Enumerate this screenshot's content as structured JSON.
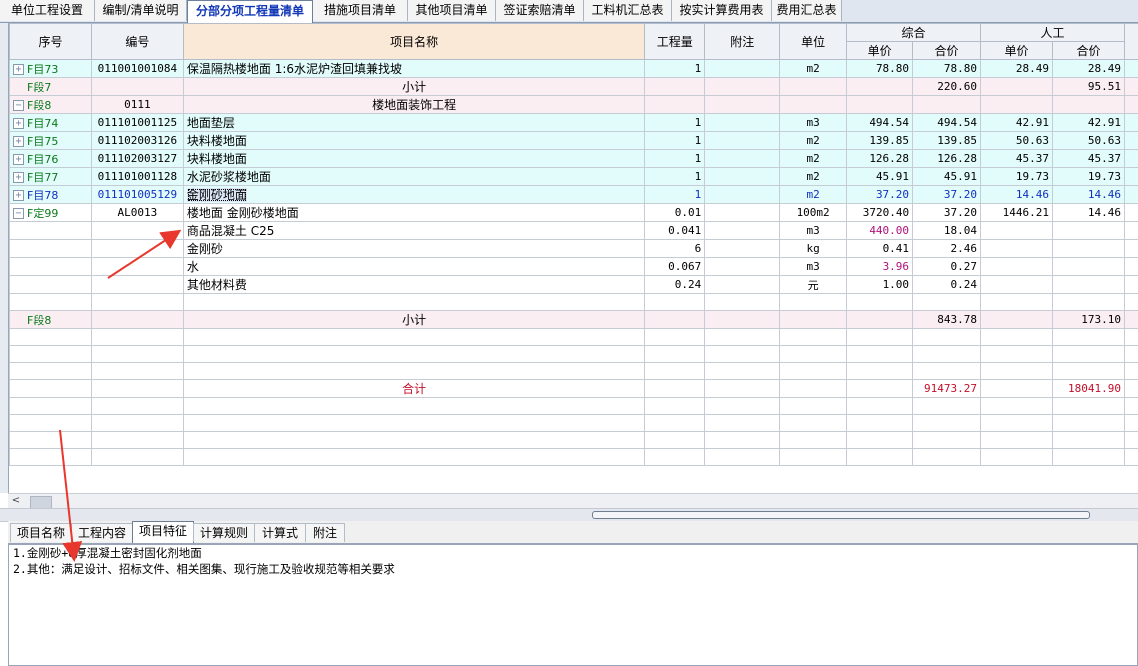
{
  "tabs": [
    {
      "label": "单位工程设置"
    },
    {
      "label": "编制/清单说明"
    },
    {
      "label": "分部分项工程量清单"
    },
    {
      "label": "措施项目清单"
    },
    {
      "label": "其他项目清单"
    },
    {
      "label": "签证索赔清单"
    },
    {
      "label": "工料机汇总表"
    },
    {
      "label": "按实计算费用表"
    },
    {
      "label": "费用汇总表"
    }
  ],
  "active_tab_index": 2,
  "table": {
    "headers": {
      "seq": "序号",
      "code": "编号",
      "name": "项目名称",
      "qty": "工程量",
      "note": "附注",
      "unit": "单位",
      "group_total": "综合",
      "group_labor": "人工",
      "unit_price": "单价",
      "amount": "合价"
    },
    "rows": [
      {
        "type": "item",
        "seq": "F目73",
        "code": "011001001084",
        "name": "保温隔热楼地面 1:6水泥炉渣回填兼找坡",
        "qty": "1",
        "unit": "m2",
        "price": "78.80",
        "amount": "78.80",
        "lprice": "28.49",
        "lamount": "28.49"
      },
      {
        "type": "sub",
        "seq": "F段7",
        "code": "",
        "name": "小计",
        "qty": "",
        "unit": "",
        "price": "",
        "amount": "220.60",
        "lprice": "",
        "lamount": "95.51"
      },
      {
        "type": "sub",
        "seq": "F段8",
        "code": "0111",
        "name": "楼地面装饰工程",
        "qty": "",
        "unit": "",
        "price": "",
        "amount": "",
        "lprice": "",
        "lamount": ""
      },
      {
        "type": "item",
        "seq": "F目74",
        "code": "011101001125",
        "name": "地面垫层",
        "qty": "1",
        "unit": "m3",
        "price": "494.54",
        "amount": "494.54",
        "lprice": "42.91",
        "lamount": "42.91"
      },
      {
        "type": "item",
        "seq": "F目75",
        "code": "011102003126",
        "name": "块料楼地面",
        "qty": "1",
        "unit": "m2",
        "price": "139.85",
        "amount": "139.85",
        "lprice": "50.63",
        "lamount": "50.63"
      },
      {
        "type": "item",
        "seq": "F目76",
        "code": "011102003127",
        "name": "块料楼地面",
        "qty": "1",
        "unit": "m2",
        "price": "126.28",
        "amount": "126.28",
        "lprice": "45.37",
        "lamount": "45.37"
      },
      {
        "type": "item",
        "seq": "F目77",
        "code": "011101001128",
        "name": "水泥砂浆楼地面",
        "qty": "1",
        "unit": "m2",
        "price": "45.91",
        "amount": "45.91",
        "lprice": "19.73",
        "lamount": "19.73"
      },
      {
        "type": "item",
        "seq": "F目78",
        "code": "011101005129",
        "name": "金刚砂地面",
        "qty": "1",
        "unit": "m2",
        "price": "37.20",
        "amount": "37.20",
        "lprice": "14.46",
        "lamount": "14.46"
      },
      {
        "type": "plain",
        "seq": "F定99",
        "code": "AL0013",
        "name": "楼地面 金刚砂楼地面",
        "qty": "0.01",
        "unit": "100m2",
        "price": "3720.40",
        "amount": "37.20",
        "lprice": "1446.21",
        "lamount": "14.46"
      },
      {
        "type": "plain",
        "seq": "",
        "code": "",
        "name": "商品混凝土 C25",
        "qty": "0.041",
        "unit": "m3",
        "price": "440.00",
        "amount": "18.04",
        "lprice": "",
        "lamount": ""
      },
      {
        "type": "plain",
        "seq": "",
        "code": "",
        "name": "金刚砂",
        "qty": "6",
        "unit": "kg",
        "price": "0.41",
        "amount": "2.46",
        "lprice": "",
        "lamount": ""
      },
      {
        "type": "plain",
        "seq": "",
        "code": "",
        "name": "水",
        "qty": "0.067",
        "unit": "m3",
        "price": "3.96",
        "amount": "0.27",
        "lprice": "",
        "lamount": ""
      },
      {
        "type": "plain",
        "seq": "",
        "code": "",
        "name": "其他材料费",
        "qty": "0.24",
        "unit": "元",
        "price": "1.00",
        "amount": "0.24",
        "lprice": "",
        "lamount": ""
      },
      {
        "type": "plain",
        "seq": "",
        "code": "",
        "name": "",
        "qty": "",
        "unit": "",
        "price": "",
        "amount": "",
        "lprice": "",
        "lamount": ""
      },
      {
        "type": "sub",
        "seq": "F段8",
        "code": "",
        "name": "小计",
        "qty": "",
        "unit": "",
        "price": "",
        "amount": "843.78",
        "lprice": "",
        "lamount": "173.10"
      },
      {
        "type": "plain",
        "seq": "",
        "code": "",
        "name": "",
        "qty": "",
        "unit": "",
        "price": "",
        "amount": "",
        "lprice": "",
        "lamount": ""
      },
      {
        "type": "plain",
        "seq": "",
        "code": "",
        "name": "",
        "qty": "",
        "unit": "",
        "price": "",
        "amount": "",
        "lprice": "",
        "lamount": ""
      },
      {
        "type": "plain",
        "seq": "",
        "code": "",
        "name": "",
        "qty": "",
        "unit": "",
        "price": "",
        "amount": "",
        "lprice": "",
        "lamount": ""
      },
      {
        "type": "plain",
        "seq": "",
        "code": "",
        "name": "合计",
        "qty": "",
        "unit": "",
        "price": "",
        "amount": "91473.27",
        "lprice": "",
        "lamount": "18041.90"
      },
      {
        "type": "plain",
        "seq": "",
        "code": "",
        "name": "",
        "qty": "",
        "unit": "",
        "price": "",
        "amount": "",
        "lprice": "",
        "lamount": ""
      },
      {
        "type": "plain",
        "seq": "",
        "code": "",
        "name": "",
        "qty": "",
        "unit": "",
        "price": "",
        "amount": "",
        "lprice": "",
        "lamount": ""
      },
      {
        "type": "plain",
        "seq": "",
        "code": "",
        "name": "",
        "qty": "",
        "unit": "",
        "price": "",
        "amount": "",
        "lprice": "",
        "lamount": ""
      },
      {
        "type": "plain",
        "seq": "",
        "code": "",
        "name": "",
        "qty": "",
        "unit": "",
        "price": "",
        "amount": "",
        "lprice": "",
        "lamount": ""
      }
    ]
  },
  "bottom_tabs": [
    {
      "label": "项目名称"
    },
    {
      "label": "工程内容"
    },
    {
      "label": "项目特征"
    },
    {
      "label": "计算规则"
    },
    {
      "label": "计算式"
    },
    {
      "label": "附注"
    }
  ],
  "active_bottom_tab_index": 2,
  "detail_lines": [
    "1.金刚砂+8厚混凝土密封固化剂地面",
    "2.其他：满足设计、招标文件、相关图集、现行施工及验收规范等相关要求"
  ],
  "colors": {
    "item_row": "#e2fbfb",
    "subtotal_row": "#fbeef3",
    "seq_text": "#0a7a1a",
    "selected_row_text": "#1030c0",
    "material_price_text": "#b0107a",
    "total_text": "#c40f2a",
    "annotation_arrow": "#e8372c"
  }
}
